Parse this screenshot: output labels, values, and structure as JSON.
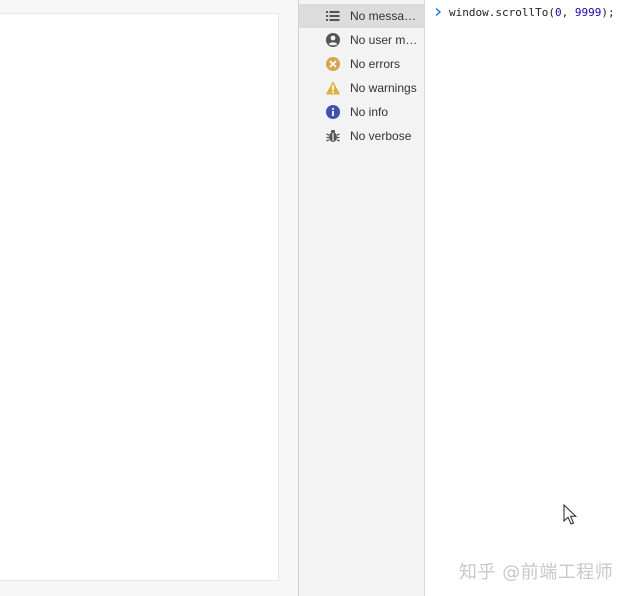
{
  "sidebar": {
    "items": [
      {
        "label": "No messages",
        "icon": "list-icon",
        "selected": true
      },
      {
        "label": "No user me...",
        "icon": "user-icon",
        "selected": false
      },
      {
        "label": "No errors",
        "icon": "error-icon",
        "selected": false
      },
      {
        "label": "No warnings",
        "icon": "warning-icon",
        "selected": false
      },
      {
        "label": "No info",
        "icon": "info-icon",
        "selected": false
      },
      {
        "label": "No verbose",
        "icon": "bug-icon",
        "selected": false
      }
    ]
  },
  "console": {
    "prompt_icon": "chevron-right-icon",
    "code_prefix": "window.scrollTo(",
    "arg1": "0",
    "separator": ", ",
    "arg2": "9999",
    "code_suffix": ");"
  },
  "watermark": {
    "text": "知乎 @前端工程师"
  },
  "colors": {
    "error": "#d9a44a",
    "warning": "#e0b23b",
    "info": "#3f51b5",
    "icon_gray": "#555555",
    "selected_bg": "#dcdcdc"
  }
}
